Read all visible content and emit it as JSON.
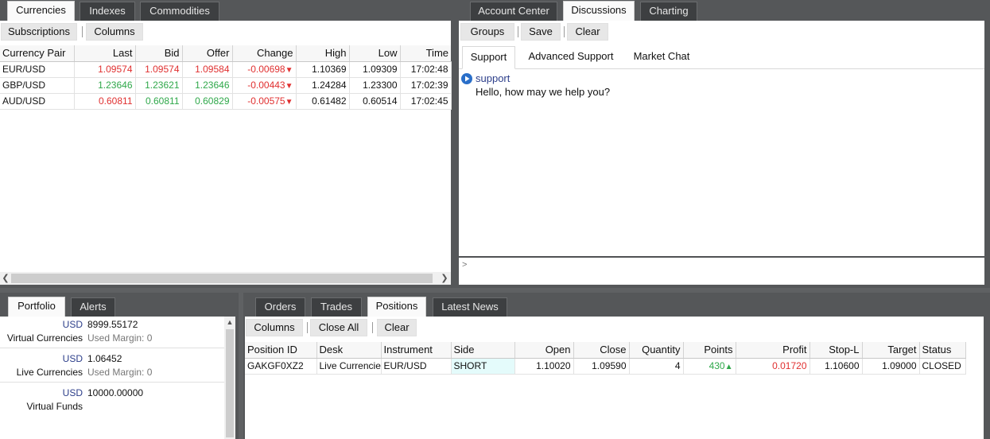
{
  "left_tabs": [
    "Currencies",
    "Indexes",
    "Commodities"
  ],
  "right_tabs": [
    "Account Center",
    "Discussions",
    "Charting"
  ],
  "quotes_toolbar": {
    "subscriptions": "Subscriptions",
    "columns": "Columns"
  },
  "quotes": {
    "columns": [
      "Currency Pair",
      "Last",
      "Bid",
      "Offer",
      "Change",
      "High",
      "Low",
      "Time"
    ],
    "rows": [
      {
        "pair": "EUR/USD",
        "last": "1.09574",
        "bid": "1.09574",
        "offer": "1.09584",
        "change": "-0.00698",
        "high": "1.10369",
        "low": "1.09309",
        "time": "17:02:48",
        "last_color": "red",
        "bid_color": "red",
        "offer_color": "red"
      },
      {
        "pair": "GBP/USD",
        "last": "1.23646",
        "bid": "1.23621",
        "offer": "1.23646",
        "change": "-0.00443",
        "high": "1.24284",
        "low": "1.23300",
        "time": "17:02:39",
        "last_color": "green",
        "bid_color": "green",
        "offer_color": "green"
      },
      {
        "pair": "AUD/USD",
        "last": "0.60811",
        "bid": "0.60811",
        "offer": "0.60829",
        "change": "-0.00575",
        "high": "0.61482",
        "low": "0.60514",
        "time": "17:02:45",
        "last_color": "red",
        "bid_color": "green",
        "offer_color": "green"
      }
    ]
  },
  "discussions_toolbar": {
    "groups": "Groups",
    "save": "Save",
    "clear": "Clear"
  },
  "discussion_subtabs": [
    "Support",
    "Advanced Support",
    "Market Chat"
  ],
  "chat": {
    "sender": "support",
    "message": "Hello, how may we help you?",
    "input_prompt": ">"
  },
  "bottom_left_tabs": [
    "Portfolio",
    "Alerts"
  ],
  "portfolio": [
    {
      "currency": "USD",
      "amount": "8999.55172",
      "name": "Virtual Currencies",
      "margin": "Used Margin: 0"
    },
    {
      "currency": "USD",
      "amount": "1.06452",
      "name": "Live Currencies",
      "margin": "Used Margin: 0"
    },
    {
      "currency": "USD",
      "amount": "10000.00000",
      "name": "Virtual Funds",
      "margin": ""
    }
  ],
  "bottom_right_tabs": [
    "Orders",
    "Trades",
    "Positions",
    "Latest News"
  ],
  "positions_toolbar": {
    "columns": "Columns",
    "close_all": "Close All",
    "clear": "Clear"
  },
  "positions": {
    "columns": [
      "Position ID",
      "Desk",
      "Instrument",
      "Side",
      "Open",
      "Close",
      "Quantity",
      "Points",
      "Profit",
      "Stop-L",
      "Target",
      "Status"
    ],
    "rows": [
      {
        "id": "GAKGF0XZ2",
        "desk": "Live Currencies",
        "instrument": "EUR/USD",
        "side": "SHORT",
        "open": "1.10020",
        "close": "1.09590",
        "quantity": "4",
        "points": "430",
        "profit": "0.01720",
        "stop": "1.10600",
        "target": "1.09000",
        "status": "CLOSED"
      }
    ]
  },
  "colors": {
    "frame": "#555759",
    "tab_inactive": "#3d3f41",
    "red": "#e03030",
    "green": "#2fa84a",
    "short_bg": "#e4fbfb"
  }
}
